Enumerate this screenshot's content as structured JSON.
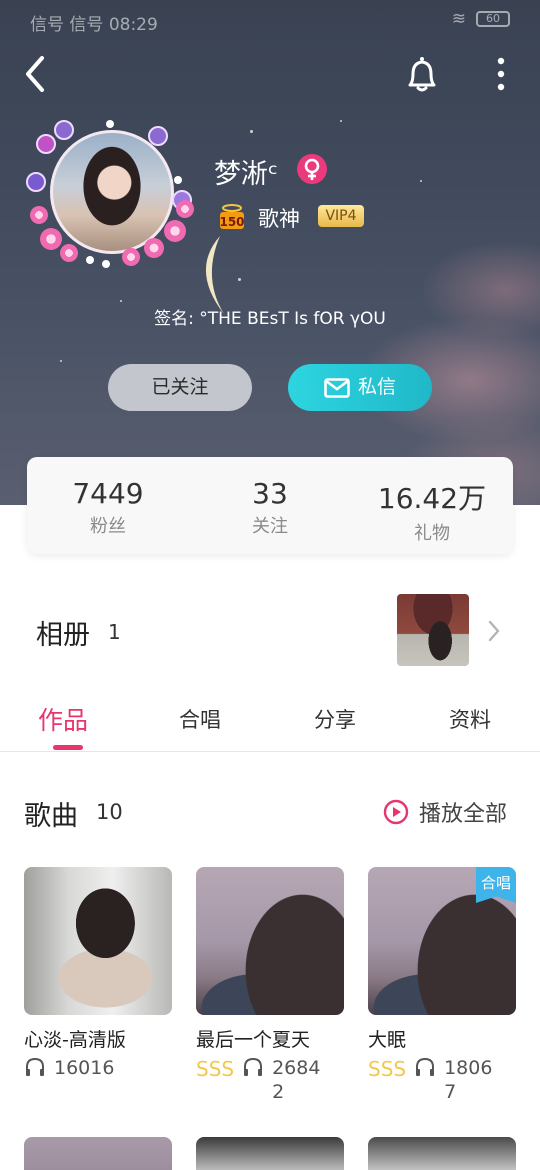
{
  "status_bar": {
    "signal": "信号 信号",
    "time": "08:29",
    "battery": "60"
  },
  "header": {
    "nickname": "梦淅ᶜ",
    "gender_symbol": "♀",
    "level_badge": "150",
    "title": "歌神",
    "vip": "VIP4",
    "signature": "签名: °THE BEsT Is fOR γOU",
    "follow_button": "已关注",
    "message_button": "私信"
  },
  "stats": [
    {
      "value": "7449",
      "label": "粉丝"
    },
    {
      "value": "33",
      "label": "关注"
    },
    {
      "value": "16.42万",
      "label": "礼物"
    }
  ],
  "album": {
    "title": "相册",
    "count": "1"
  },
  "tabs": [
    "作品",
    "合唱",
    "分享",
    "资料"
  ],
  "songs": {
    "title": "歌曲",
    "count": "10",
    "play_all": "播放全部",
    "items": [
      {
        "name": "心淡-高清版",
        "rating": "",
        "plays": "16016",
        "duet": ""
      },
      {
        "name": "最后一个夏天",
        "rating": "SSS",
        "plays": "26842",
        "duet": ""
      },
      {
        "name": "大眠",
        "rating": "SSS",
        "plays": "18067",
        "duet": "合唱"
      }
    ]
  },
  "icons": {
    "back": "chevron-left-icon",
    "bell": "bell-icon",
    "more": "more-vertical-icon",
    "mail": "mail-icon",
    "play": "play-circle-icon",
    "headphones": "headphones-icon"
  },
  "colors": {
    "accent": "#e8356c",
    "message_button": "#20b8c8",
    "rating": "#f3c84a",
    "duet_tag": "#3fb4ea"
  }
}
